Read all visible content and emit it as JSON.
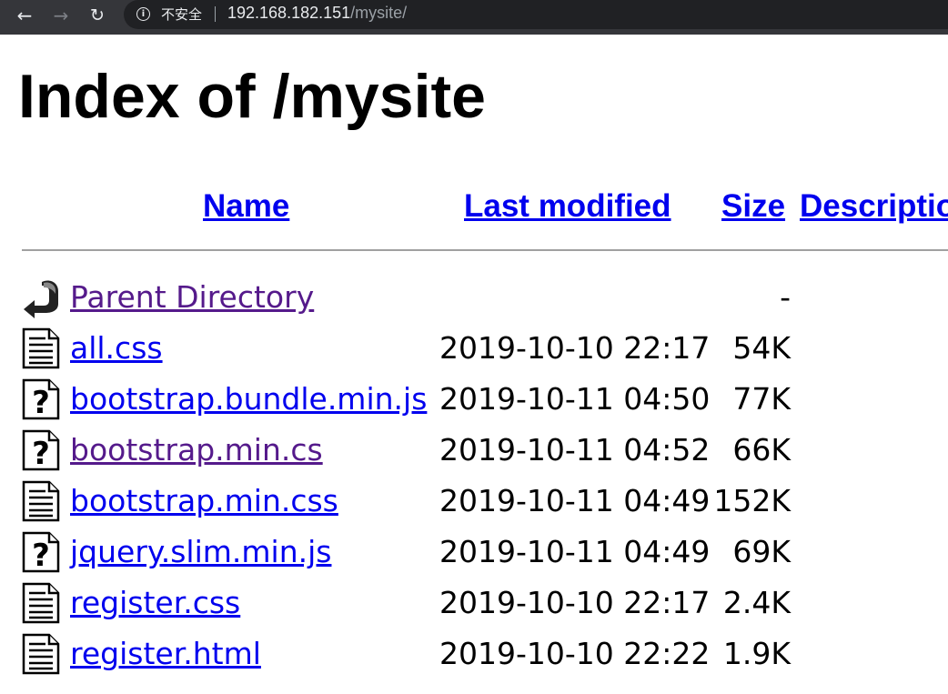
{
  "browser": {
    "security_label": "不安全",
    "url_host": "192.168.182.151",
    "url_path": "/mysite/"
  },
  "page": {
    "title": "Index of /mysite"
  },
  "columns": {
    "name": "Name",
    "last_modified": "Last modified",
    "size": "Size",
    "description": "Description"
  },
  "rows": [
    {
      "icon": "back-arrow-icon",
      "name": "Parent Directory",
      "modified": "",
      "size": "-",
      "visited": true
    },
    {
      "icon": "text-file-icon",
      "name": "all.css",
      "modified": "2019-10-10 22:17",
      "size": "54K",
      "visited": false
    },
    {
      "icon": "unknown-file-icon",
      "name": "bootstrap.bundle.min.js",
      "modified": "2019-10-11 04:50",
      "size": "77K",
      "visited": false
    },
    {
      "icon": "unknown-file-icon",
      "name": "bootstrap.min.cs",
      "modified": "2019-10-11 04:52",
      "size": "66K",
      "visited": true
    },
    {
      "icon": "text-file-icon",
      "name": "bootstrap.min.css",
      "modified": "2019-10-11 04:49",
      "size": "152K",
      "visited": false
    },
    {
      "icon": "unknown-file-icon",
      "name": "jquery.slim.min.js",
      "modified": "2019-10-11 04:49",
      "size": "69K",
      "visited": false
    },
    {
      "icon": "text-file-icon",
      "name": "register.css",
      "modified": "2019-10-10 22:17",
      "size": "2.4K",
      "visited": false
    },
    {
      "icon": "text-file-icon",
      "name": "register.html",
      "modified": "2019-10-10 22:22",
      "size": "1.9K",
      "visited": false
    }
  ]
}
